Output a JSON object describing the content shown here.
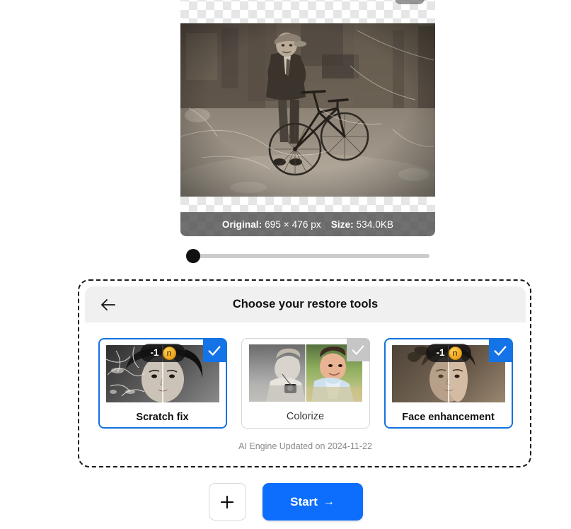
{
  "preview": {
    "crop_icon": "crop-icon",
    "info": {
      "original_label": "Original:",
      "original_value": "695 × 476 px",
      "size_label": "Size:",
      "size_value": "534.0KB"
    },
    "photo_alt": "vintage sepia photograph of a boy standing with a bicycle"
  },
  "slider": {
    "value": 0,
    "min": 0,
    "max": 100
  },
  "panel": {
    "back_icon": "arrow-left-icon",
    "title": "Choose your restore tools",
    "ai_note": "AI Engine Updated on 2024-11-22",
    "tools": [
      {
        "label": "Scratch fix",
        "selected": true,
        "credit_cost": "-1",
        "coin_letter": "n",
        "thumb": "scratch-fix-before-after"
      },
      {
        "label": "Colorize",
        "selected": false,
        "credit_cost": "",
        "coin_letter": "",
        "thumb": "colorize-before-after"
      },
      {
        "label": "Face enhancement",
        "selected": true,
        "credit_cost": "-1",
        "coin_letter": "n",
        "thumb": "face-enhancement-before-after"
      }
    ]
  },
  "footer": {
    "add_label": "+",
    "start_label": "Start",
    "start_arrow": "→"
  },
  "colors": {
    "accent_blue": "#0d6efd",
    "badge_blue": "#1473e6",
    "badge_gray": "#c6c6c6",
    "coin_gold": "#f0a91e",
    "panel_header_bg": "#f0f0f0"
  }
}
